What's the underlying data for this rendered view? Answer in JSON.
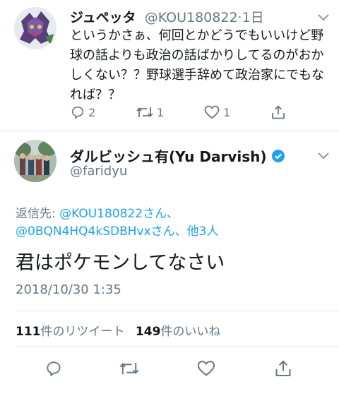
{
  "tweet_top": {
    "display_name": "ジュペッタ",
    "handle": "@KOU180822",
    "separator": "·",
    "time": "1日",
    "text": "というかさぁ、何回とかどうでもいいけど野球の話よりも政治の話ばかりしてるのがおかしくない？？野球選手辞めて政治家にでもなれば？？",
    "reply_count": "2",
    "retweet_count": "1",
    "like_count": "1",
    "icons": {
      "reply": "reply-icon",
      "retweet": "retweet-icon",
      "like": "heart-icon",
      "share": "share-icon",
      "more": "chevron-down-icon"
    }
  },
  "tweet_main": {
    "display_name": "ダルビッシュ有(Yu Darvish)",
    "handle": "@faridyu",
    "reply_label": "返信先: ",
    "reply_mention_1": "@KOU180822さん",
    "reply_sep": "、",
    "reply_mention_2": "@0BQN4HQ4kSDBHvxさん",
    "reply_others": "、他3人",
    "text": "君はポケモンしてなさい",
    "timestamp": "2018/10/30 1:35",
    "retweet_count": "111",
    "retweet_label": "件のリツイート",
    "like_count": "149",
    "like_label": "件のいいね"
  },
  "colors": {
    "accent": "#1da1f2",
    "muted": "#657786",
    "text": "#14171a",
    "divider": "#e1e8ed"
  }
}
